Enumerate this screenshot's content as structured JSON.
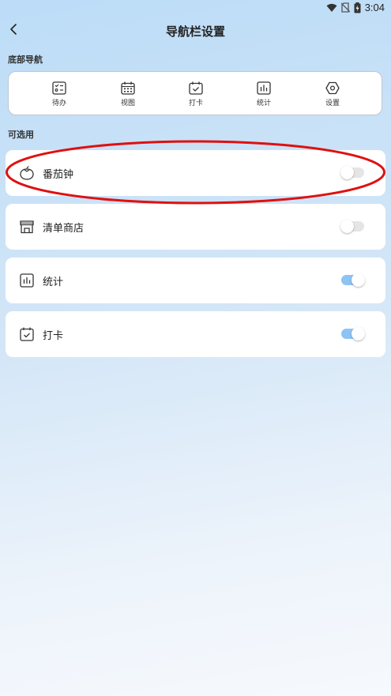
{
  "status_bar": {
    "time": "3:04",
    "icons": [
      "wifi-icon",
      "no-sim-icon",
      "battery-charging-icon"
    ]
  },
  "header": {
    "title": "导航栏设置",
    "back_icon": "chevron-left-icon"
  },
  "bottom_nav_section": {
    "label": "底部导航",
    "items": [
      {
        "label": "待办",
        "icon": "todo-list-icon"
      },
      {
        "label": "视图",
        "icon": "calendar-grid-icon"
      },
      {
        "label": "打卡",
        "icon": "calendar-check-icon"
      },
      {
        "label": "统计",
        "icon": "bar-chart-icon"
      },
      {
        "label": "设置",
        "icon": "settings-hexagon-icon"
      }
    ]
  },
  "available_section": {
    "label": "可选用",
    "items": [
      {
        "label": "番茄钟",
        "icon": "tomato-icon",
        "enabled": false
      },
      {
        "label": "清单商店",
        "icon": "store-icon",
        "enabled": false
      },
      {
        "label": "统计",
        "icon": "bar-chart-icon",
        "enabled": true
      },
      {
        "label": "打卡",
        "icon": "calendar-check-icon",
        "enabled": true
      }
    ]
  },
  "colors": {
    "toggle_on": "#8ec4f4",
    "toggle_off": "#e5e5e5",
    "highlight_ellipse": "#e01010",
    "background_top": "#bcdcf7",
    "background_bottom": "#f6f9fd"
  }
}
